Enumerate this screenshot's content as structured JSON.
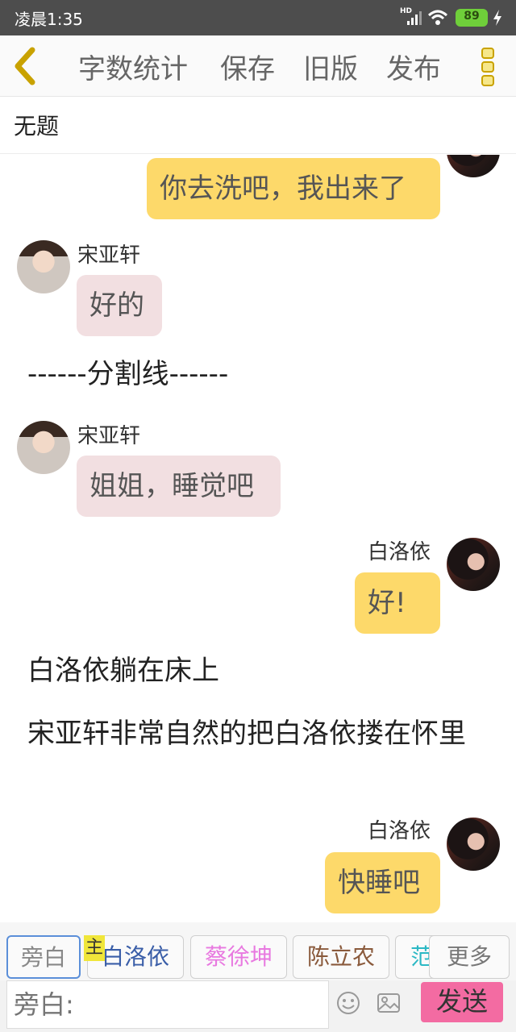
{
  "status_bar": {
    "time": "凌晨1:35",
    "hd": "HD",
    "battery": "89"
  },
  "toolbar": {
    "word_count": "字数统计",
    "save": "保存",
    "old_version": "旧版",
    "publish": "发布",
    "back_icon": "chevron-left-icon",
    "more_icon": "vertical-dots-icon"
  },
  "title": "无题",
  "messages": [
    {
      "side": "right",
      "text": "你去洗吧，我出来了"
    },
    {
      "side": "left",
      "name": "宋亚轩",
      "text": "好的"
    },
    {
      "type": "narration",
      "text": "------分割线------"
    },
    {
      "side": "left",
      "name": "宋亚轩",
      "text": "姐姐，睡觉吧"
    },
    {
      "side": "right",
      "name": "白洛依",
      "text": "好!"
    },
    {
      "type": "narration",
      "text": "白洛依躺在床上"
    },
    {
      "type": "narration",
      "text": "宋亚轩非常自然的把白洛依搂在怀里"
    },
    {
      "side": "right",
      "name": "白洛依",
      "text": "快睡吧"
    }
  ],
  "characters": {
    "narrator": "旁白",
    "main_tag": "主",
    "bai": "白洛依",
    "cai": "蔡徐坤",
    "chen": "陈立农",
    "fan": "范",
    "more": "更多"
  },
  "input": {
    "placeholder": "旁白:",
    "send": "发送"
  },
  "colors": {
    "accent_yellow": "#fdd96a",
    "bubble_pink": "#f2dfe1",
    "send_pink": "#f36ba2",
    "back_icon": "#c9a200"
  }
}
